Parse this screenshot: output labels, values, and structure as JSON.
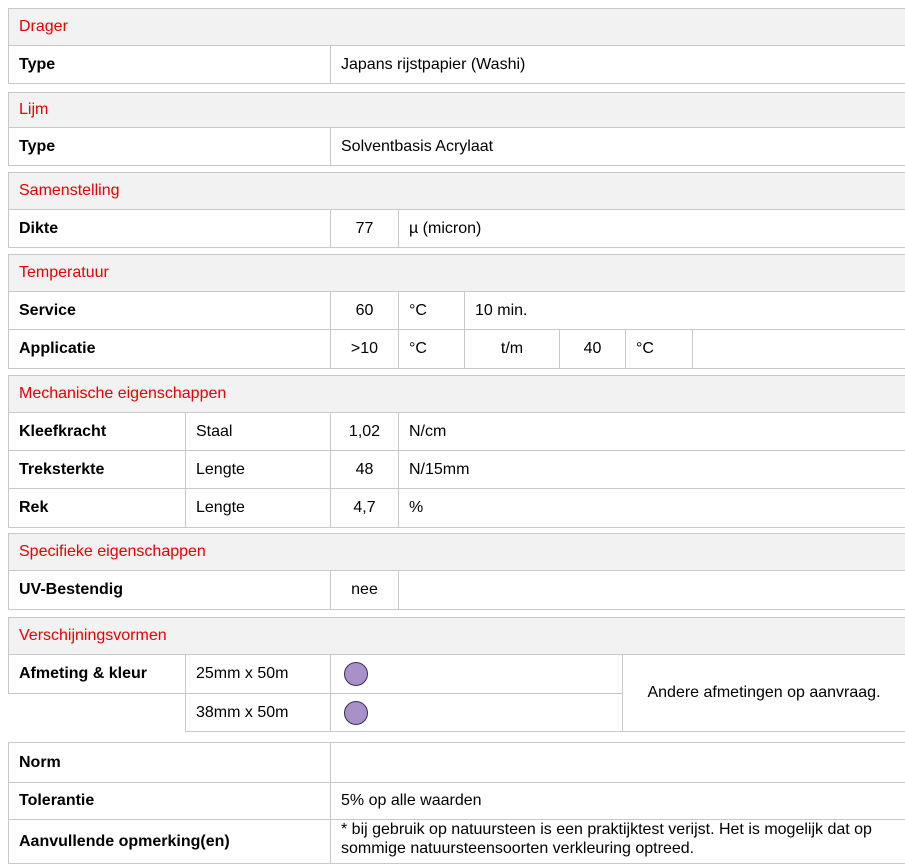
{
  "drager": {
    "title": "Drager",
    "type_label": "Type",
    "type_value": "Japans rijstpapier (Washi)"
  },
  "lijm": {
    "title": "Lijm",
    "type_label": "Type",
    "type_value": "Solventbasis Acrylaat"
  },
  "samenstelling": {
    "title": "Samenstelling",
    "dikte_label": "Dikte",
    "dikte_value": "77",
    "dikte_unit": "µ (micron)"
  },
  "temperatuur": {
    "title": "Temperatuur",
    "service_label": "Service",
    "service_value": "60",
    "service_unit": "°C",
    "service_time": "10 min.",
    "applicatie_label": "Applicatie",
    "applicatie_min": ">10",
    "applicatie_min_unit": "°C",
    "applicatie_tm": "t/m",
    "applicatie_max": "40",
    "applicatie_max_unit": "°C"
  },
  "mechanisch": {
    "title": "Mechanische eigenschappen",
    "rows": [
      {
        "label": "Kleefkracht",
        "sub": "Staal",
        "value": "1,02",
        "unit": "N/cm"
      },
      {
        "label": "Treksterkte",
        "sub": "Lengte",
        "value": "48",
        "unit": "N/15mm"
      },
      {
        "label": "Rek",
        "sub": "Lengte",
        "value": "4,7",
        "unit": "%"
      }
    ]
  },
  "specifiek": {
    "title": "Specifieke eigenschappen",
    "uv_label": "UV-Bestendig",
    "uv_value": "nee"
  },
  "verschijning": {
    "title": "Verschijningsvormen",
    "label": "Afmeting & kleur",
    "sizes": [
      "25mm x 50m",
      "38mm x 50m"
    ],
    "swatch_color": "#a891c8",
    "note": "Andere afmetingen op aanvraag."
  },
  "footer": {
    "norm_label": "Norm",
    "norm_value": "",
    "tolerantie_label": "Tolerantie",
    "tolerantie_value": "5% op alle waarden",
    "opmerking_label": "Aanvullende opmerking(en)",
    "opmerking_value": "* bij gebruik op natuursteen is een praktijktest verijst. Het is mogelijk dat op sommige natuursteensoorten verkleuring optreed."
  }
}
